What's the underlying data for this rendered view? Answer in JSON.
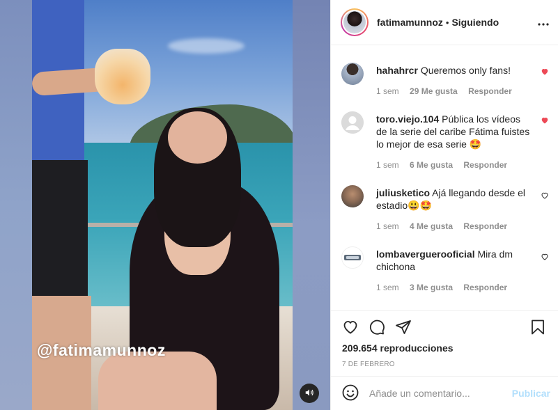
{
  "media": {
    "watermark": "@fatimamunnoz",
    "sound_icon": "volume-icon"
  },
  "header": {
    "username": "fatimamunnoz",
    "separator": "•",
    "follow_state": "Siguiendo",
    "more_icon": "more-options-icon"
  },
  "comments": [
    {
      "username": "hahahrcr",
      "text": "Queremos only fans!",
      "time": "1 sem",
      "likes": "29 Me gusta",
      "reply": "Responder",
      "liked": true
    },
    {
      "username": "toro.viejo.104",
      "text": "Pública los vídeos de la serie del caribe Fátima fuistes lo mejor de esa serie 🤩",
      "time": "1 sem",
      "likes": "6 Me gusta",
      "reply": "Responder",
      "liked": true
    },
    {
      "username": "juliusketico",
      "text": "Ajá llegando desde el estadio😃🤩",
      "time": "1 sem",
      "likes": "4 Me gusta",
      "reply": "Responder",
      "liked": false
    },
    {
      "username": "lombaverguerooficial",
      "text": "Mira dm chichona",
      "time": "1 sem",
      "likes": "3 Me gusta",
      "reply": "Responder",
      "liked": false
    }
  ],
  "actions": {
    "views": "209.654 reproducciones",
    "date": "7 DE FEBRERO"
  },
  "add_comment": {
    "placeholder": "Añade un comentario...",
    "publish_label": "Publicar"
  },
  "colors": {
    "liked_heart": "#ed4956",
    "publish_disabled": "#b2dffc",
    "meta_gray": "#8e8e8e",
    "text": "#262626"
  }
}
